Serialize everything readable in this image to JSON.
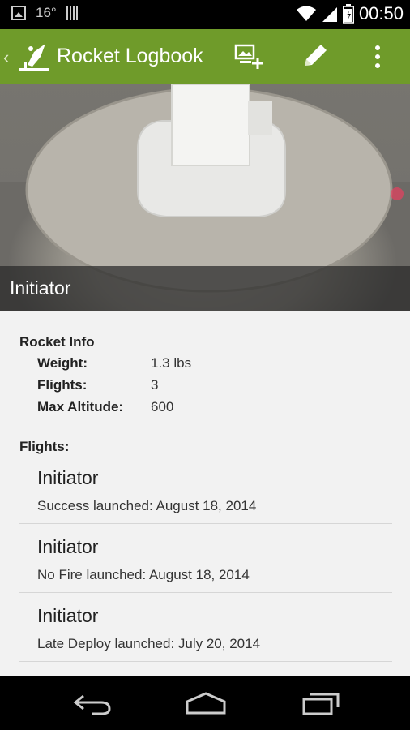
{
  "status_bar": {
    "temperature": "16°",
    "time": "00:50",
    "icons": [
      "image-icon",
      "barcode-icon",
      "wifi-icon",
      "signal-icon",
      "battery-icon"
    ]
  },
  "action_bar": {
    "title": "Rocket Logbook",
    "icons": [
      "back-chevron-icon",
      "rocket-logo-icon",
      "add-photo-icon",
      "edit-pencil-icon",
      "overflow-menu-icon"
    ],
    "accent": "#6f9b2a"
  },
  "hero": {
    "caption": "Initiator"
  },
  "rocket_info": {
    "heading": "Rocket Info",
    "rows": [
      {
        "label": "Weight:",
        "value": "1.3 lbs"
      },
      {
        "label": "Flights:",
        "value": "3"
      },
      {
        "label": "Max Altitude:",
        "value": "600"
      }
    ]
  },
  "flights": {
    "heading": "Flights:",
    "items": [
      {
        "name": "Initiator",
        "detail": "Success launched: August 18, 2014"
      },
      {
        "name": "Initiator",
        "detail": "No Fire launched: August 18, 2014"
      },
      {
        "name": "Initiator",
        "detail": "Late Deploy launched: July 20, 2014"
      }
    ]
  },
  "nav_bar": {
    "icons": [
      "back-icon",
      "home-icon",
      "recents-icon"
    ]
  }
}
